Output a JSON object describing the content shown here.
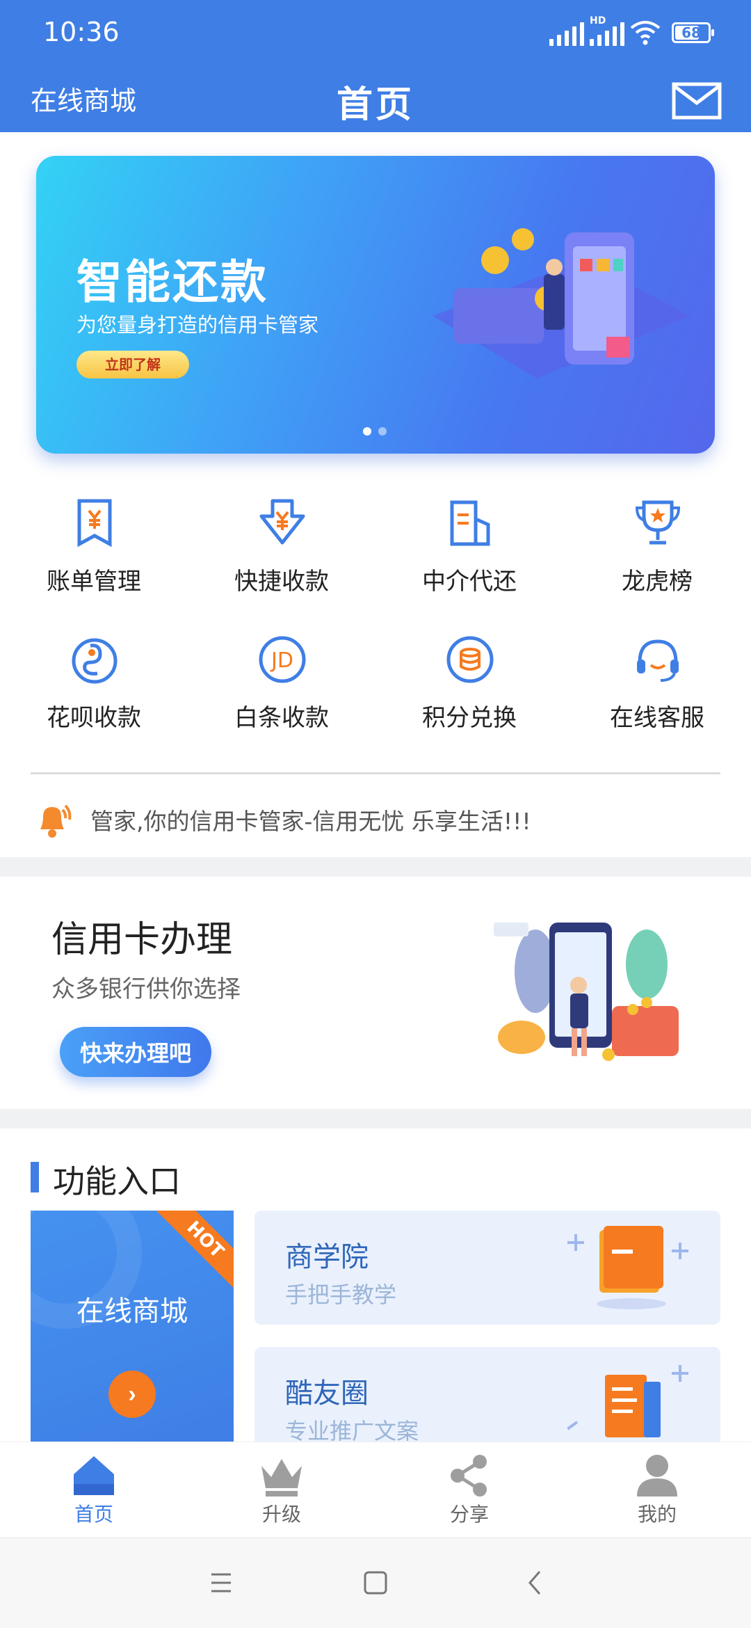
{
  "status_bar": {
    "time": "10:36",
    "hd": "HD",
    "battery": "68"
  },
  "header": {
    "left_label": "在线商城",
    "title": "首页"
  },
  "banner": {
    "title": "智能还款",
    "subtitle": "为您量身打造的信用卡管家",
    "button": "立即了解"
  },
  "grid": [
    {
      "label": "账单管理",
      "icon": "bill-icon"
    },
    {
      "label": "快捷收款",
      "icon": "receive-icon"
    },
    {
      "label": "中介代还",
      "icon": "agent-icon"
    },
    {
      "label": "龙虎榜",
      "icon": "trophy-icon"
    },
    {
      "label": "花呗收款",
      "icon": "huabei-icon"
    },
    {
      "label": "白条收款",
      "icon": "jd-icon"
    },
    {
      "label": "积分兑换",
      "icon": "points-icon"
    },
    {
      "label": "在线客服",
      "icon": "headset-icon"
    }
  ],
  "notice": {
    "text": "管家,你的信用卡管家-信用无忧 乐享生活!!!"
  },
  "credit_card": {
    "title": "信用卡办理",
    "subtitle": "众多银行供你选择",
    "button": "快来办理吧"
  },
  "functions": {
    "title": "功能入口",
    "mall": {
      "label": "在线商城",
      "badge": "HOT"
    },
    "items": [
      {
        "title": "商学院",
        "subtitle": "手把手教学"
      },
      {
        "title": "酷友圈",
        "subtitle": "专业推广文案"
      }
    ]
  },
  "tabs": [
    {
      "label": "首页",
      "icon": "home-icon"
    },
    {
      "label": "升级",
      "icon": "crown-icon"
    },
    {
      "label": "分享",
      "icon": "share-icon"
    },
    {
      "label": "我的",
      "icon": "user-icon"
    }
  ],
  "colors": {
    "primary": "#3f7ee5",
    "accent": "#f67a1f"
  }
}
